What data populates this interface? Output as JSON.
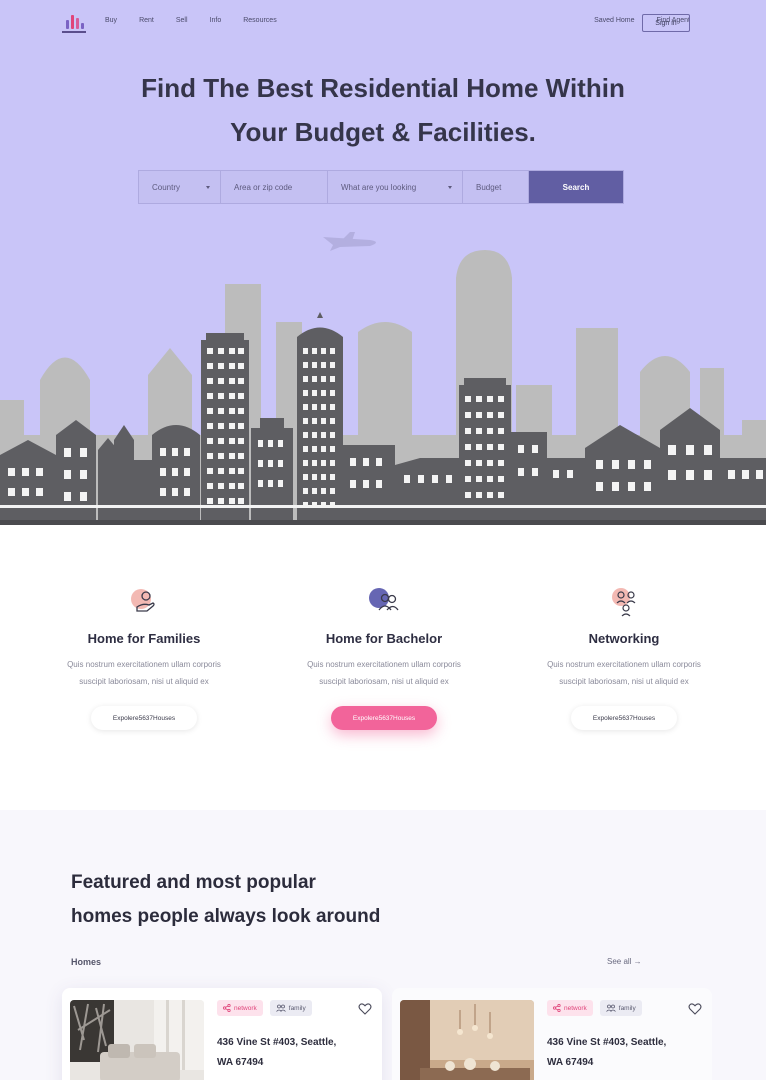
{
  "nav": {
    "links": [
      "Buy",
      "Rent",
      "Sell",
      "Info",
      "Resources"
    ],
    "saved_home": "Saved Home",
    "find_agent": "Find Agent",
    "sign_in": "Sign in"
  },
  "hero": {
    "headline_line1": "Find The Best Residential Home Within",
    "headline_line2": "Your Budget & Facilities."
  },
  "search": {
    "country": "Country",
    "area_placeholder": "Area or zip code",
    "looking": "What are you looking",
    "budget": "Budget",
    "button": "Search"
  },
  "features": [
    {
      "title": "Home for Families",
      "desc": "Quis nostrum exercitationem ullam corporis suscipit laboriosam, nisi ut aliquid ex",
      "button": "Expolere5637Houses",
      "icon": "family-hand-icon"
    },
    {
      "title": "Home for Bachelor",
      "desc": "Quis nostrum exercitationem ullam corporis suscipit laboriosam, nisi ut aliquid ex",
      "button": "Expolere5637Houses",
      "icon": "people-icon"
    },
    {
      "title": "Networking",
      "desc": "Quis nostrum exercitationem ullam corporis suscipit laboriosam, nisi ut aliquid ex",
      "button": "Expolere5637Houses",
      "icon": "network-people-icon"
    }
  ],
  "featured": {
    "title_line1": "Featured and most popular",
    "title_line2": "homes people always look around",
    "homes_label": "Homes",
    "see_all": "See all →"
  },
  "cards": [
    {
      "tag1": "network",
      "tag2": "family",
      "address_line1": "436 Vine St #403, Seattle,",
      "address_line2": "WA 67494"
    },
    {
      "tag1": "network",
      "tag2": "family",
      "address_line1": "436 Vine St #403, Seattle,",
      "address_line2": "WA 67494"
    }
  ],
  "colors": {
    "hero_bg": "#c9c5f8",
    "search_button": "#615ea3",
    "accent_pink": "#f2649a",
    "building_grey": "#5e5e62",
    "skyline_grey": "#bdbdbd"
  }
}
